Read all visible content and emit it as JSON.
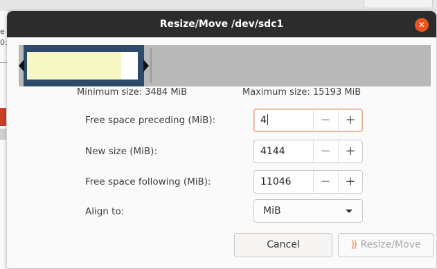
{
  "background": {
    "fragments": [
      "e",
      "0:"
    ]
  },
  "dialog": {
    "title": "Resize/Move /dev/sdc1",
    "close_icon": "close-icon",
    "min_size_label": "Minimum size: 3484 MiB",
    "max_size_label": "Maximum size: 15193 MiB",
    "fields": [
      {
        "label": "Free space preceding (MiB):",
        "value": "4"
      },
      {
        "label": "New size (MiB):",
        "value": "4144"
      },
      {
        "label": "Free space following (MiB):",
        "value": "11046"
      }
    ],
    "spin_minus": "−",
    "spin_plus": "+",
    "align": {
      "label": "Align to:",
      "value": "MiB"
    },
    "buttons": {
      "cancel": "Cancel",
      "resize_move": "Resize/Move"
    },
    "resize_icon": "resize-move-icon",
    "colors": {
      "titlebar": "#2c2c2c",
      "close": "#e95420",
      "partition_frame": "#2e4a6a",
      "partition_used": "#f7f7c6",
      "unallocated": "#b8b8b8"
    }
  }
}
